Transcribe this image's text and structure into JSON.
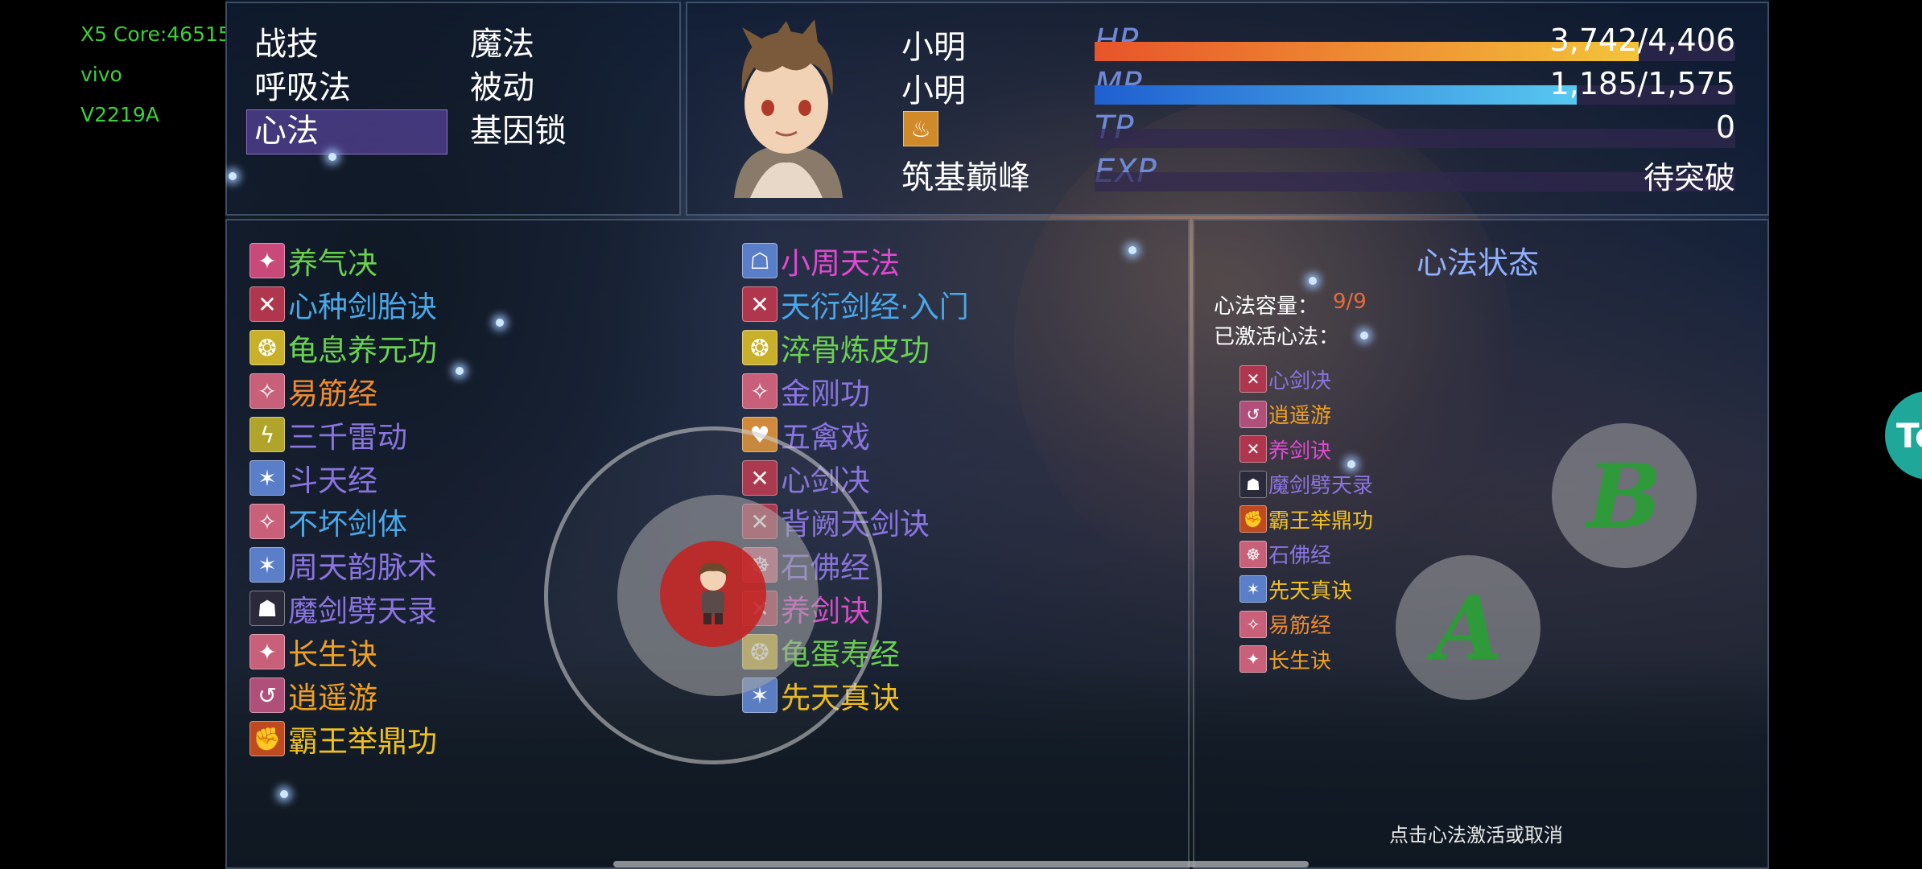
{
  "device_overlay": {
    "core": "X5 Core:46515",
    "brand": "vivo",
    "model": "V2219A"
  },
  "command_menu": {
    "items": [
      "战技",
      "魔法",
      "呼吸法",
      "被动",
      "心法",
      "基因锁"
    ],
    "selected": "心法"
  },
  "status": {
    "name": "小明",
    "nickname": "小明",
    "state_icon": "lotus-state-icon",
    "realm": "筑基巅峰",
    "gauges": [
      {
        "label": "HP",
        "value": "3,742/4,406",
        "ratio": 0.849,
        "color_start": "#e8542a",
        "color_end": "#f3c43a"
      },
      {
        "label": "MP",
        "value": "1,185/1,575",
        "ratio": 0.752,
        "color_start": "#1f5fd0",
        "color_end": "#58c8f0"
      },
      {
        "label": "TP",
        "value": "0",
        "ratio": 0,
        "color_start": "#3aa04a",
        "color_end": "#8ad25a"
      },
      {
        "label": "EXP",
        "value": "待突破",
        "ratio": 0,
        "color_start": "#8a8a8a",
        "color_end": "#cfcfcf"
      }
    ]
  },
  "skills_left": [
    {
      "name": "养气决",
      "color": "#6ad24e",
      "icon_color": "#c94a7a",
      "icon_glyph": "✦"
    },
    {
      "name": "心种剑胎诀",
      "color": "#4aa7e8",
      "icon_color": "#b0364e",
      "icon_glyph": "✕"
    },
    {
      "name": "龟息养元功",
      "color": "#6ad24e",
      "icon_color": "#c9b02a",
      "icon_glyph": "❂"
    },
    {
      "name": "易筋经",
      "color": "#f08a2c",
      "icon_color": "#c9607a",
      "icon_glyph": "✧"
    },
    {
      "name": "三千雷动",
      "color": "#8a74e0",
      "icon_color": "#b0a42a",
      "icon_glyph": "ϟ"
    },
    {
      "name": "斗天经",
      "color": "#8a74e0",
      "icon_color": "#5a7ec8",
      "icon_glyph": "✶"
    },
    {
      "name": "不坏剑体",
      "color": "#4aa7e8",
      "icon_color": "#c9607a",
      "icon_glyph": "✧"
    },
    {
      "name": "周天韵脉术",
      "color": "#8a74e0",
      "icon_color": "#5a7ec8",
      "icon_glyph": "✶"
    },
    {
      "name": "魔剑劈天录",
      "color": "#8a74e0",
      "icon_color": "#2a2a3a",
      "icon_glyph": "☗"
    },
    {
      "name": "长生诀",
      "color": "#f0a020",
      "icon_color": "#c9607a",
      "icon_glyph": "✦"
    },
    {
      "name": "逍遥游",
      "color": "#f0a020",
      "icon_color": "#b0507a",
      "icon_glyph": "↺"
    },
    {
      "name": "霸王举鼎功",
      "color": "#f0c020",
      "icon_color": "#c04a20",
      "icon_glyph": "✊"
    }
  ],
  "skills_right": [
    {
      "name": "小周天法",
      "color": "#e04ad0",
      "icon_color": "#5a7ec8",
      "icon_glyph": "☖"
    },
    {
      "name": "天衍剑经·入门",
      "color": "#4aa7e8",
      "icon_color": "#b0364e",
      "icon_glyph": "✕"
    },
    {
      "name": "淬骨炼皮功",
      "color": "#6ad24e",
      "icon_color": "#c9b02a",
      "icon_glyph": "❂"
    },
    {
      "name": "金刚功",
      "color": "#8a74e0",
      "icon_color": "#c9607a",
      "icon_glyph": "✧"
    },
    {
      "name": "五禽戏",
      "color": "#8a74e0",
      "icon_color": "#d08a3a",
      "icon_glyph": "♥"
    },
    {
      "name": "心剑决",
      "color": "#8a74e0",
      "icon_color": "#b0364e",
      "icon_glyph": "✕"
    },
    {
      "name": "背阙天剑诀",
      "color": "#8a74e0",
      "icon_color": "#b0364e",
      "icon_glyph": "✕"
    },
    {
      "name": "石佛经",
      "color": "#8a74e0",
      "icon_color": "#c9607a",
      "icon_glyph": "☸"
    },
    {
      "name": "养剑诀",
      "color": "#e04ad0",
      "icon_color": "#b0364e",
      "icon_glyph": "✕"
    },
    {
      "name": "龟蛋寿经",
      "color": "#6ad24e",
      "icon_color": "#c9b02a",
      "icon_glyph": "❂"
    },
    {
      "name": "先天真诀",
      "color": "#f0c020",
      "icon_color": "#5a7ec8",
      "icon_glyph": "✶"
    }
  ],
  "side": {
    "title": "心法状态",
    "capacity_label": "心法容量：",
    "capacity_value": "9/9",
    "active_label": "已激活心法：",
    "active": [
      {
        "name": "心剑决",
        "color": "#8a74e0",
        "icon_color": "#b0364e",
        "icon_glyph": "✕"
      },
      {
        "name": "逍遥游",
        "color": "#f0a020",
        "icon_color": "#b0507a",
        "icon_glyph": "↺"
      },
      {
        "name": "养剑诀",
        "color": "#e04ad0",
        "icon_color": "#b0364e",
        "icon_glyph": "✕"
      },
      {
        "name": "魔剑劈天录",
        "color": "#8a74e0",
        "icon_color": "#2a2a3a",
        "icon_glyph": "☗"
      },
      {
        "name": "霸王举鼎功",
        "color": "#f0c020",
        "icon_color": "#c04a20",
        "icon_glyph": "✊"
      },
      {
        "name": "石佛经",
        "color": "#8a74e0",
        "icon_color": "#c9607a",
        "icon_glyph": "☸"
      },
      {
        "name": "先天真诀",
        "color": "#f0c020",
        "icon_color": "#5a7ec8",
        "icon_glyph": "✶"
      },
      {
        "name": "易筋经",
        "color": "#f08a2c",
        "icon_color": "#c9607a",
        "icon_glyph": "✧"
      },
      {
        "name": "长生诀",
        "color": "#f0a020",
        "icon_color": "#c9607a",
        "icon_glyph": "✦"
      }
    ],
    "hint": "点击心法激活或取消"
  },
  "controls": {
    "a_label": "A",
    "b_label": "B",
    "float_tab_label": "To"
  },
  "colors": {
    "capacity_value": "#e86a3a",
    "side_title": "#8fb0ff",
    "side_label": "#ffffff"
  }
}
